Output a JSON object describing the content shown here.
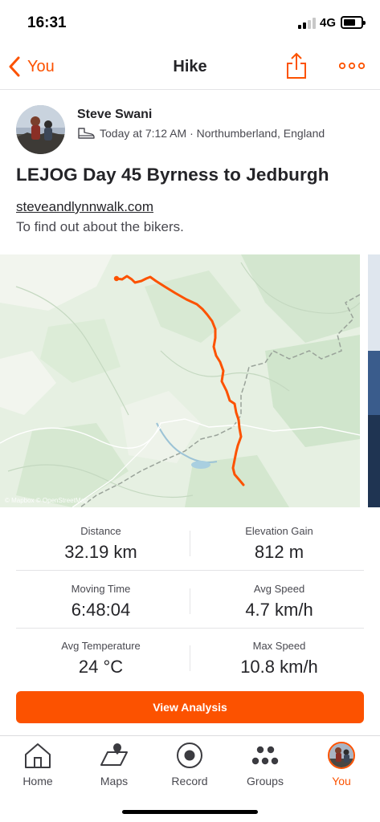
{
  "status_bar": {
    "time": "16:31",
    "network": "4G",
    "signal_icon": "signal-bars-icon",
    "battery_icon": "battery-icon",
    "battery_level": 0.55
  },
  "nav": {
    "back_label": "You",
    "back_icon": "chevron-left-icon",
    "title": "Hike",
    "share_icon": "share-icon",
    "more_icon": "more-dots-icon",
    "accent_color": "#fc5200"
  },
  "activity": {
    "athlete_name": "Steve Swani",
    "activity_icon": "hiking-boot-icon",
    "meta": "Today at 7:12 AM · Northumberland, England",
    "title": "LEJOG Day 45 Byrness to Jedburgh",
    "link_text": "steveandlynnwalk.com",
    "description": "To find out about the bikers."
  },
  "map": {
    "attribution": "© Mapbox © OpenStreetMap",
    "route_color": "#fc5200"
  },
  "stats": [
    {
      "label": "Distance",
      "value": "32.19 km"
    },
    {
      "label": "Elevation Gain",
      "value": "812 m"
    },
    {
      "label": "Moving Time",
      "value": "6:48:04"
    },
    {
      "label": "Avg Speed",
      "value": "4.7 km/h"
    },
    {
      "label": "Avg Temperature",
      "value": "24 °C"
    },
    {
      "label": "Max Speed",
      "value": "10.8 km/h"
    }
  ],
  "view_analysis_label": "View Analysis",
  "tabs": [
    {
      "label": "Home",
      "icon": "home-icon",
      "active": false
    },
    {
      "label": "Maps",
      "icon": "map-icon",
      "active": false
    },
    {
      "label": "Record",
      "icon": "record-icon",
      "active": false
    },
    {
      "label": "Groups",
      "icon": "groups-icon",
      "active": false
    },
    {
      "label": "You",
      "icon": "profile-avatar-icon",
      "active": true
    }
  ]
}
